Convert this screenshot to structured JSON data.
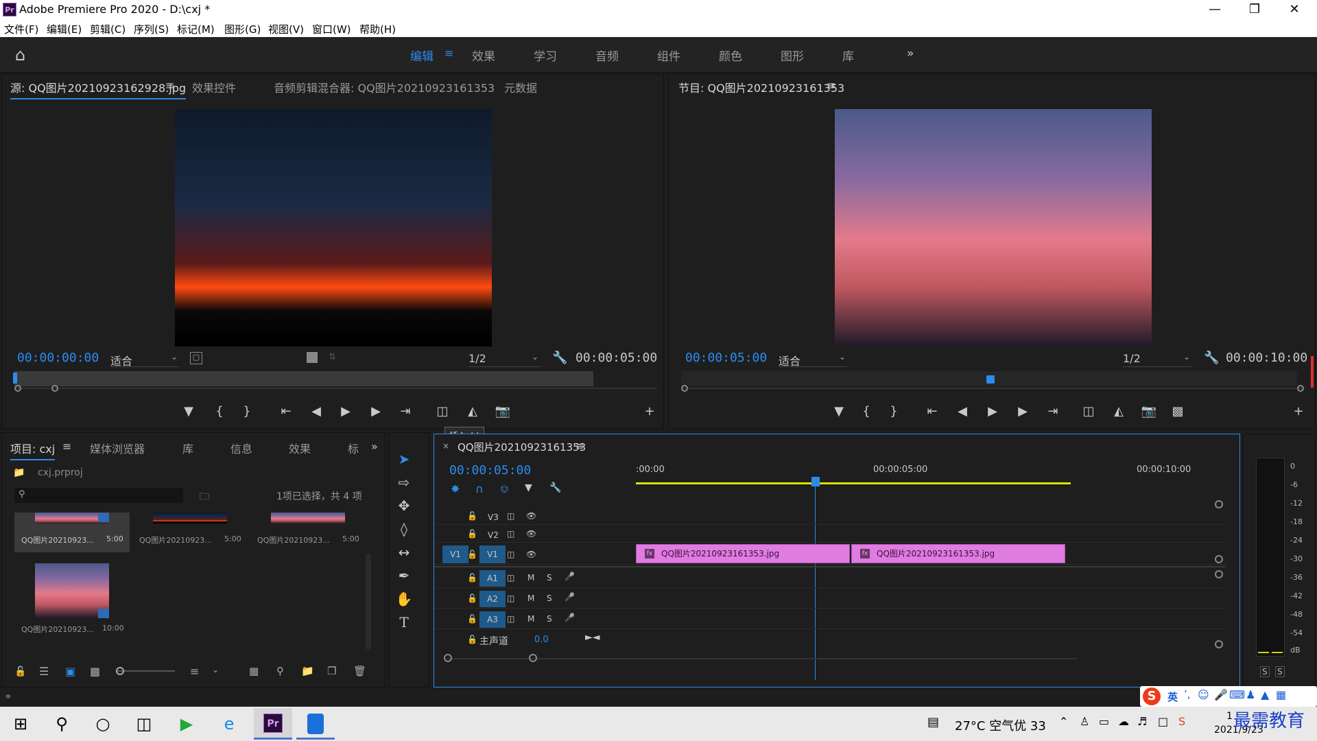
{
  "window": {
    "title": "Adobe Premiere Pro 2020 - D:\\cxj *",
    "app_icon": "Pr"
  },
  "menu": [
    "文件(F)",
    "编辑(E)",
    "剪辑(C)",
    "序列(S)",
    "标记(M)",
    "图形(G)",
    "视图(V)",
    "窗口(W)",
    "帮助(H)"
  ],
  "workspaces": {
    "items": [
      "编辑",
      "效果",
      "学习",
      "音频",
      "组件",
      "颜色",
      "图形",
      "库"
    ],
    "active": "编辑"
  },
  "source": {
    "tabs": [
      "源: QQ图片20210923162928.jpg",
      "效果控件",
      "音频剪辑混合器: QQ图片20210923161353",
      "元数据"
    ],
    "timecode": "00:00:00:00",
    "fit": "适合",
    "resolution": "1/2",
    "duration": "00:00:05:00"
  },
  "program": {
    "tab": "节目: QQ图片20210923161353",
    "timecode": "00:00:05:00",
    "fit": "适合",
    "resolution": "1/2",
    "duration": "00:00:10:00"
  },
  "tooltip": "插入 (,)",
  "project": {
    "tabs": [
      "项目: cxj",
      "媒体浏览器",
      "库",
      "信息",
      "效果",
      "标"
    ],
    "file": "cxj.prproj",
    "selection_text": "1项已选择，共 4 项",
    "items": [
      {
        "name": "QQ图片20210923...",
        "dur": "5:00"
      },
      {
        "name": "QQ图片20210923...",
        "dur": "5:00"
      },
      {
        "name": "QQ图片20210923...",
        "dur": "5:00"
      },
      {
        "name": "QQ图片20210923...",
        "dur": "10:00"
      }
    ]
  },
  "timeline": {
    "tab": "QQ图片20210923161353",
    "timecode": "00:00:05:00",
    "ruler": [
      ":00:00",
      "00:00:05:00",
      "00:00:10:00"
    ],
    "video_tracks": [
      "V3",
      "V2",
      "V1"
    ],
    "audio_tracks": [
      "A1",
      "A2",
      "A3"
    ],
    "source_patch": "V1",
    "mute_label": "M",
    "solo_label": "S",
    "master_label": "主声道",
    "master_value": "0.0",
    "clips": [
      {
        "name": "QQ图片20210923161353.jpg"
      },
      {
        "name": "QQ图片20210923161353.jpg"
      }
    ]
  },
  "meter": {
    "labels": [
      "0",
      "-6",
      "-12",
      "-18",
      "-24",
      "-30",
      "-36",
      "-42",
      "-48",
      "-54",
      "dB"
    ],
    "solo": [
      "S",
      "S"
    ]
  },
  "ime": {
    "lang": "英"
  },
  "taskbar": {
    "weather": "27°C  空气优 33",
    "date": "2021/9/23",
    "watermark": "最需教育",
    "time_fragment": "1"
  }
}
